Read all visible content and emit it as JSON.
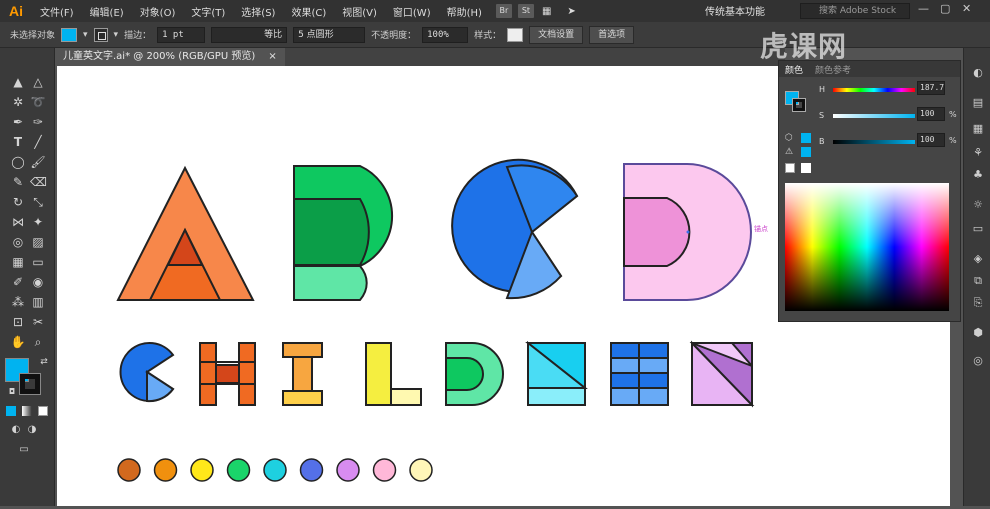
{
  "app": {
    "logo": "Ai",
    "menu": [
      "文件(F)",
      "编辑(E)",
      "对象(O)",
      "文字(T)",
      "选择(S)",
      "效果(C)",
      "视图(V)",
      "窗口(W)",
      "帮助(H)"
    ],
    "bridge_buttons": [
      "Br",
      "St"
    ],
    "workspace": "传统基本功能",
    "stock_search_placeholder": "搜索 Adobe Stock"
  },
  "control_bar": {
    "selection_status": "未选择对象",
    "fill_color": "#00b3f0",
    "stroke_label": "描边：",
    "stroke_weight": "1 pt",
    "stroke_profile": "等比",
    "brush": "5 点圆形",
    "opacity_label": "不透明度：",
    "opacity_value": "100%",
    "style_label": "样式：",
    "doc_setup_button": "文档设置",
    "preferences_button": "首选项"
  },
  "document_tab": {
    "title": "儿童英文字.ai* @ 200% (RGB/GPU 预览)",
    "close": "×"
  },
  "color_panel": {
    "tabs": [
      "颜色",
      "颜色参考"
    ],
    "h_label": "H",
    "h_value": "187.7",
    "s_label": "S",
    "s_value": "100",
    "b_label": "B",
    "b_value": "100",
    "percent": "%"
  },
  "canvas": {
    "anchor_label": "锚点",
    "palette_colors": [
      "#d2691e",
      "#f0900e",
      "#ffe81a",
      "#1ad46a",
      "#1ed0e0",
      "#5470e8",
      "#d88cf0",
      "#ffb8d8",
      "#fff6b8"
    ]
  },
  "watermark": "虎课网"
}
